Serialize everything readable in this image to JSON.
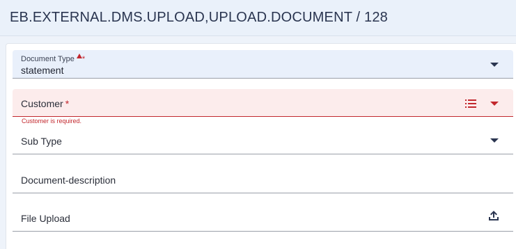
{
  "header": {
    "title": "EB.EXTERNAL.DMS.UPLOAD,UPLOAD.DOCUMENT / 128"
  },
  "form": {
    "document_type": {
      "label": "Document Type",
      "required_marker": "*",
      "value": "statement",
      "icon": "dropdown-caret-icon"
    },
    "customer": {
      "label": "Customer",
      "required_marker": "*",
      "error": "Customer is required.",
      "icons": [
        "list-icon",
        "dropdown-caret-icon"
      ],
      "error_color": "#c2272d"
    },
    "sub_type": {
      "label": "Sub Type",
      "icon": "dropdown-caret-icon"
    },
    "document_description": {
      "label": "Document-description"
    },
    "file_upload": {
      "label": "File Upload",
      "icon": "upload-icon"
    }
  },
  "colors": {
    "accent": "#2a3550",
    "error": "#c2272d",
    "field_fill": "#e9f0fb"
  }
}
